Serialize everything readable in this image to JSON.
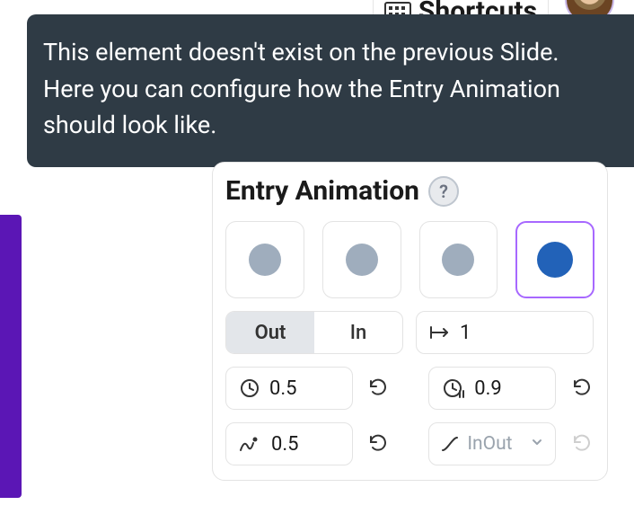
{
  "topbar": {
    "shortcuts_label": "Shortcuts"
  },
  "tooltip": {
    "text": "This element doesn't exist on the previous Slide. Here you can configure how the Entry Animation should look like."
  },
  "panel": {
    "title": "Entry Animation",
    "help": "?",
    "presets": [
      {
        "selected": false
      },
      {
        "selected": false
      },
      {
        "selected": false
      },
      {
        "selected": true
      }
    ],
    "segmented": {
      "out": "Out",
      "in": "In",
      "active": "out"
    },
    "distance_value": "1",
    "duration_value": "0.5",
    "delay_value": "0.9",
    "bounce_value": "0.5",
    "easing_value": "InOut"
  }
}
